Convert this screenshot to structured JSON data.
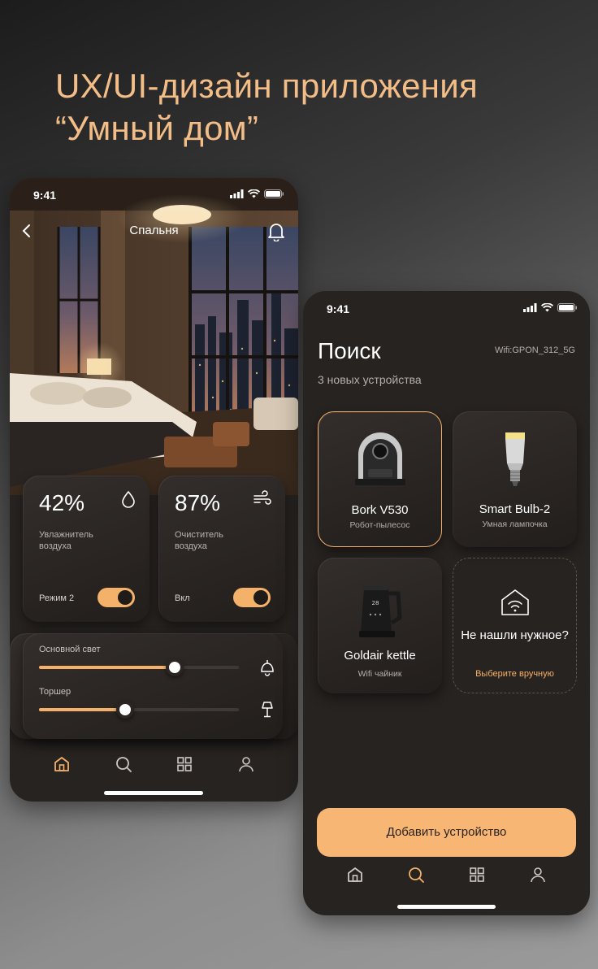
{
  "headline": {
    "line1": "UX/UI-дизайн приложения",
    "line2": "“Умный дом”"
  },
  "colors": {
    "accent": "#f4b16a",
    "card": "#2b2623",
    "title": "#f3bd88"
  },
  "phone1": {
    "time": "9:41",
    "room_title": "Спальня",
    "humidifier": {
      "value": "42%",
      "label": "Увлажнитель воздуха",
      "mode": "Режим 2",
      "toggle_on": true,
      "icon": "droplet-icon"
    },
    "purifier": {
      "value": "87%",
      "label": "Очиститель воздуха",
      "mode": "Вкл",
      "toggle_on": true,
      "icon": "wind-icon"
    },
    "lights": [
      {
        "label": "Основной свет",
        "level": 0.68,
        "icon": "ceiling-lamp-icon"
      },
      {
        "label": "Торшер",
        "level": 0.43,
        "icon": "floor-lamp-icon"
      }
    ],
    "nav": [
      "home-icon",
      "search-icon",
      "grid-icon",
      "user-icon"
    ],
    "nav_active": "home"
  },
  "phone2": {
    "time": "9:41",
    "title": "Поиск",
    "subtitle": "3 новых устройства",
    "wifi": "Wifi:GPON_312_5G",
    "devices": [
      {
        "name": "Bork V530",
        "type": "Робот-пылесос",
        "selected": true
      },
      {
        "name": "Smart Bulb-2",
        "type": "Умная лампочка",
        "selected": false
      },
      {
        "name": "Goldair kettle",
        "type": "Wifi чайник",
        "selected": false
      }
    ],
    "not_found": {
      "question": "Не нашли нужное?",
      "action": "Выберите вручную",
      "kettle_display": "28"
    },
    "add_button": "Добавить устройство",
    "nav": [
      "home-icon",
      "search-icon",
      "grid-icon",
      "user-icon"
    ],
    "nav_active": "search"
  }
}
